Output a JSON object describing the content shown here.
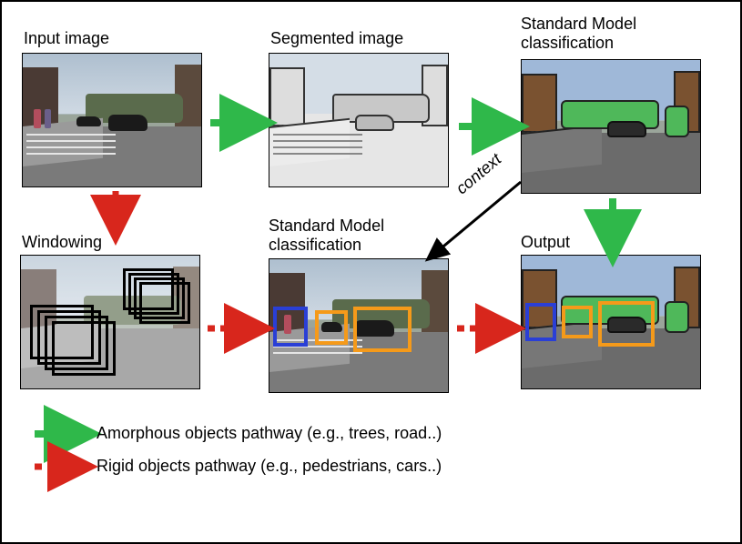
{
  "labels": {
    "input": "Input image",
    "segmented": "Segmented image",
    "smc_top": "Standard Model\nclassification",
    "windowing": "Windowing",
    "smc_bottom": "Standard Model\nclassification",
    "output": "Output",
    "context": "context"
  },
  "legend": {
    "amorphous": "Amorphous objects pathway (e.g., trees, road..)",
    "rigid": "Rigid objects pathway (e.g., pedestrians, cars..)"
  },
  "colors": {
    "green": "#2fb84a",
    "red": "#d8261c",
    "orange": "#f59a1a",
    "blue": "#2a3fd6"
  }
}
